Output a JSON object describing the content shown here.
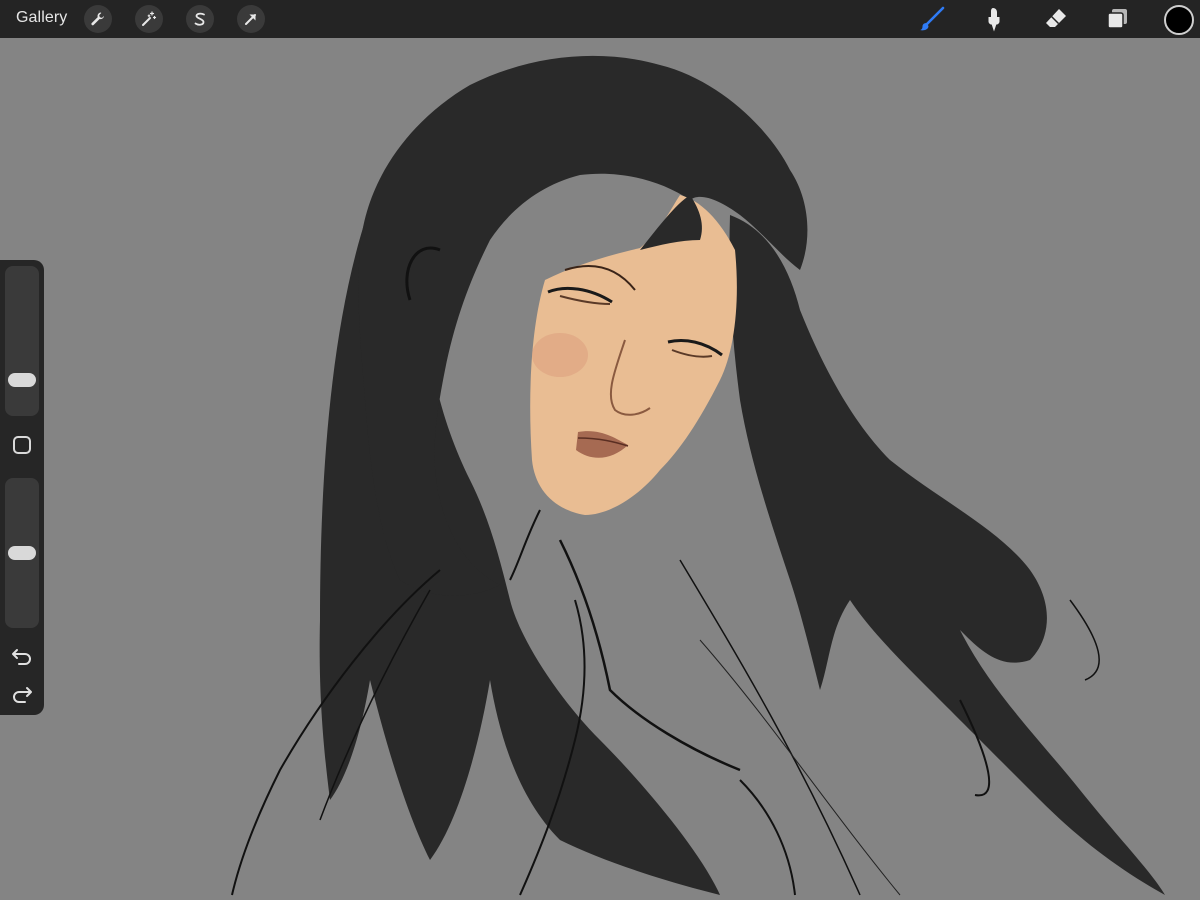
{
  "topbar": {
    "gallery_label": "Gallery",
    "left_tools": [
      "wrench-icon",
      "magic-wand-icon",
      "selection-s-icon",
      "transform-arrow-icon"
    ],
    "right_tools": [
      "brush-icon",
      "smudge-icon",
      "eraser-icon",
      "layers-icon"
    ],
    "active_tool": "brush-icon",
    "current_color": "#000000",
    "accent_color": "#2f7bf5"
  },
  "sidebar": {
    "brush_size_level": 0.2,
    "opacity_level": 0.5,
    "icons": [
      "modify-square-icon",
      "undo-icon",
      "redo-icon"
    ]
  },
  "canvas": {
    "background_color": "#848484"
  }
}
